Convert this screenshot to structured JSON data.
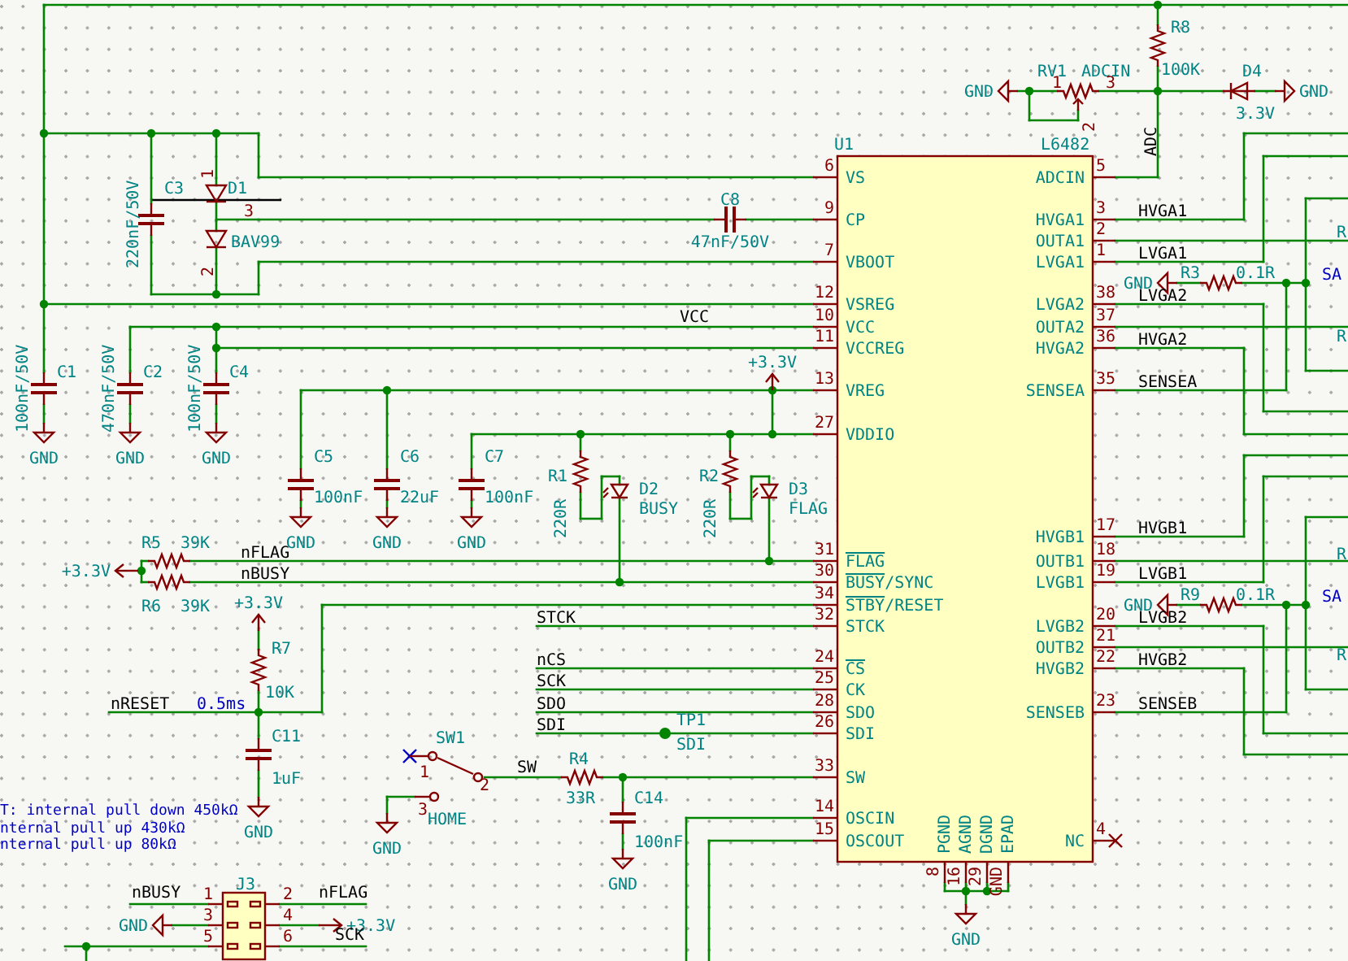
{
  "chip": {
    "ref": "U1",
    "part": "L6482",
    "left_pins": [
      {
        "number": "6",
        "name": "VS",
        "inverted": false
      },
      {
        "number": "9",
        "name": "CP",
        "inverted": false
      },
      {
        "number": "7",
        "name": "VBOOT",
        "inverted": false
      },
      {
        "number": "12",
        "name": "VSREG",
        "inverted": false
      },
      {
        "number": "10",
        "name": "VCC",
        "inverted": false
      },
      {
        "number": "11",
        "name": "VCCREG",
        "inverted": false
      },
      {
        "number": "13",
        "name": "VREG",
        "inverted": false
      },
      {
        "number": "27",
        "name": "VDDIO",
        "inverted": false
      },
      {
        "number": "31",
        "name": "FLAG",
        "inverted": true
      },
      {
        "number": "30",
        "name": "BUSY/SYNC",
        "inverted": true
      },
      {
        "number": "34",
        "name": "STBY/RESET",
        "inverted": true
      },
      {
        "number": "32",
        "name": "STCK",
        "inverted": false
      },
      {
        "number": "24",
        "name": "CS",
        "inverted": true
      },
      {
        "number": "25",
        "name": "CK",
        "inverted": false
      },
      {
        "number": "28",
        "name": "SDO",
        "inverted": false
      },
      {
        "number": "26",
        "name": "SDI",
        "inverted": false
      },
      {
        "number": "33",
        "name": "SW",
        "inverted": false
      },
      {
        "number": "14",
        "name": "OSCIN",
        "inverted": false
      },
      {
        "number": "15",
        "name": "OSCOUT",
        "inverted": false
      }
    ],
    "right_pins": [
      {
        "number": "5",
        "name": "ADCIN"
      },
      {
        "number": "3",
        "name": "HVGA1"
      },
      {
        "number": "2",
        "name": "OUTA1"
      },
      {
        "number": "1",
        "name": "LVGA1"
      },
      {
        "number": "38",
        "name": "LVGA2"
      },
      {
        "number": "37",
        "name": "OUTA2"
      },
      {
        "number": "36",
        "name": "HVGA2"
      },
      {
        "number": "35",
        "name": "SENSEA"
      },
      {
        "number": "17",
        "name": "HVGB1"
      },
      {
        "number": "18",
        "name": "OUTB1"
      },
      {
        "number": "19",
        "name": "LVGB1"
      },
      {
        "number": "20",
        "name": "LVGB2"
      },
      {
        "number": "21",
        "name": "OUTB2"
      },
      {
        "number": "22",
        "name": "HVGB2"
      },
      {
        "number": "23",
        "name": "SENSEB"
      },
      {
        "number": "4",
        "name": "NC"
      }
    ],
    "bottom_pins": [
      {
        "number": "8",
        "name": "PGND"
      },
      {
        "number": "16",
        "name": "AGND"
      },
      {
        "number": "29",
        "name": "DGND"
      },
      {
        "number": "GND",
        "name": "EPAD"
      }
    ]
  },
  "components": [
    {
      "kind": "capacitor",
      "ref": "C3",
      "value": "220nF/50V"
    },
    {
      "kind": "diode_pair",
      "ref": "D1",
      "value": "BAV99",
      "pins": [
        "1",
        "3",
        "2"
      ]
    },
    {
      "kind": "capacitor",
      "ref": "C8",
      "value": "47nF/50V"
    },
    {
      "kind": "capacitor",
      "ref": "C1",
      "value": "100nF/50V"
    },
    {
      "kind": "capacitor",
      "ref": "C2",
      "value": "470nF/50V"
    },
    {
      "kind": "capacitor",
      "ref": "C4",
      "value": "100nF/50V"
    },
    {
      "kind": "capacitor",
      "ref": "C5",
      "value": "100nF"
    },
    {
      "kind": "capacitor",
      "ref": "C6",
      "value": "22uF"
    },
    {
      "kind": "capacitor",
      "ref": "C7",
      "value": "100nF"
    },
    {
      "kind": "resistor",
      "ref": "R1",
      "value": "220R"
    },
    {
      "kind": "led",
      "ref": "D2",
      "value": "BUSY"
    },
    {
      "kind": "resistor",
      "ref": "R2",
      "value": "220R"
    },
    {
      "kind": "led",
      "ref": "D3",
      "value": "FLAG"
    },
    {
      "kind": "resistor",
      "ref": "R5",
      "value": "39K"
    },
    {
      "kind": "resistor",
      "ref": "R6",
      "value": "39K"
    },
    {
      "kind": "resistor",
      "ref": "R7",
      "value": "10K"
    },
    {
      "kind": "capacitor",
      "ref": "C11",
      "value": "1uF"
    },
    {
      "kind": "switch",
      "ref": "SW1",
      "value": "HOME",
      "pins": [
        "1",
        "2",
        "3"
      ]
    },
    {
      "kind": "resistor",
      "ref": "R4",
      "value": "33R"
    },
    {
      "kind": "capacitor",
      "ref": "C14",
      "value": "100nF"
    },
    {
      "kind": "test_point",
      "ref": "TP1",
      "value": "SDI"
    },
    {
      "kind": "resistor",
      "ref": "R8",
      "value": "100K"
    },
    {
      "kind": "potentiometer",
      "ref": "RV1",
      "value": "ADCIN",
      "pins": [
        "1",
        "3",
        "2"
      ]
    },
    {
      "kind": "diode",
      "ref": "D4",
      "value": "3.3V"
    },
    {
      "kind": "resistor",
      "ref": "R3",
      "value": "0.1R"
    },
    {
      "kind": "resistor",
      "ref": "R9",
      "value": "0.1R"
    },
    {
      "kind": "connector",
      "ref": "J3",
      "pins": [
        "1",
        "2",
        "3",
        "4",
        "5",
        "6"
      ]
    }
  ],
  "power_ports": [
    {
      "kind": "gnd",
      "label": "GND"
    },
    {
      "kind": "gnd",
      "label": "GND"
    },
    {
      "kind": "gnd",
      "label": "GND"
    },
    {
      "kind": "gnd",
      "label": "GND"
    },
    {
      "kind": "gnd",
      "label": "GND"
    },
    {
      "kind": "gnd",
      "label": "GND"
    },
    {
      "kind": "supply",
      "label": "+3.3V"
    },
    {
      "kind": "supply",
      "label": "+3.3V"
    },
    {
      "kind": "supply",
      "label": "+3.3V"
    },
    {
      "kind": "gnd",
      "label": "GND"
    },
    {
      "kind": "gnd",
      "label": "GND"
    },
    {
      "kind": "gnd",
      "label": "GND"
    },
    {
      "kind": "gnd",
      "label": "GND"
    },
    {
      "kind": "gnd",
      "label": "GND"
    },
    {
      "kind": "gnd",
      "label": "GND"
    },
    {
      "kind": "gnd",
      "label": "GND"
    },
    {
      "kind": "gnd",
      "label": "GND"
    },
    {
      "kind": "gnd",
      "label": "GND"
    },
    {
      "kind": "supply",
      "label": "+3.3V"
    }
  ],
  "net_labels": [
    "VCC",
    "nFLAG",
    "nBUSY",
    "nRESET",
    "STCK",
    "nCS",
    "SCK",
    "SDO",
    "SDI",
    "SW",
    "ADC",
    "HVGA1",
    "LVGA1",
    "LVGA2",
    "HVGA2",
    "SENSEA",
    "HVGB1",
    "LVGB1",
    "LVGB2",
    "HVGB2",
    "SENSEB",
    "nBUSY",
    "nFLAG",
    "SCK"
  ],
  "notes": [
    "0.5ms",
    "T: internal pull down 450kΩ",
    "nternal pull up 430kΩ",
    "nternal pull up 80kΩ",
    "SA",
    "SA"
  ],
  "edge_labels": [
    "R",
    "R",
    "R",
    "R"
  ]
}
